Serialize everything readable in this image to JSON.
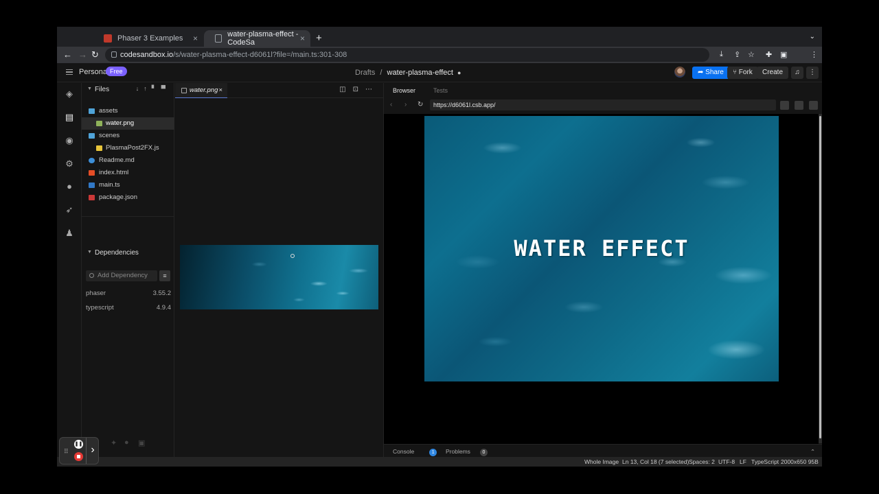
{
  "browser": {
    "tabs": [
      {
        "title": "Phaser 3 Examples",
        "close": "×"
      },
      {
        "title": "water-plasma-effect - CodeSa",
        "close": "×"
      }
    ],
    "new_tab": "+",
    "url_host": "codesandbox.io",
    "url_path": "/s/water-plasma-effect-d6061l?file=/main.ts:301-308"
  },
  "header": {
    "workspace": "Personal",
    "plan_badge": "Free",
    "crumb_parent": "Drafts",
    "crumb_sep": "/",
    "sandbox_name": "water-plasma-effect",
    "share_label": "Share",
    "fork_label": "Fork",
    "create_label": "Create"
  },
  "explorer": {
    "files_title": "Files",
    "tree": [
      {
        "name": "assets",
        "icon": "folder-icon",
        "color": "#4fa3d8"
      },
      {
        "name": "water.png",
        "icon": "image-file-icon",
        "color": "#8fb25a",
        "selected": true
      },
      {
        "name": "scenes",
        "icon": "folder-icon",
        "color": "#4fa3d8"
      },
      {
        "name": "PlasmaPost2FX.js",
        "icon": "js-file-icon",
        "color": "#e8c53a"
      },
      {
        "name": "Readme.md",
        "icon": "info-icon",
        "color": "#3d8fd8"
      },
      {
        "name": "index.html",
        "icon": "html-file-icon",
        "color": "#e44d26"
      },
      {
        "name": "main.ts",
        "icon": "ts-file-icon",
        "color": "#3178c6"
      },
      {
        "name": "package.json",
        "icon": "npm-file-icon",
        "color": "#cb3837"
      }
    ],
    "dependencies_title": "Dependencies",
    "add_dependency_placeholder": "Add Dependency",
    "dependencies": [
      {
        "name": "phaser",
        "version": "3.55.2"
      },
      {
        "name": "typescript",
        "version": "4.9.4"
      }
    ]
  },
  "editor": {
    "tab_label": "water.png",
    "tab_close": "×"
  },
  "preview": {
    "tab_browser": "Browser",
    "tab_tests": "Tests",
    "url": "https://d6061l.csb.app/",
    "canvas_text": "WATER EFFECT",
    "console_label": "Console",
    "console_count": "1",
    "problems_label": "Problems",
    "problems_count": "0"
  },
  "status": {
    "whole_image": "Whole Image",
    "cursor": "Ln 13, Col 18 (7 selected)",
    "spaces": "Spaces: 2",
    "encoding": "UTF-8",
    "eol": "LF",
    "language": "TypeScript",
    "image_info": "2000x650 95B"
  },
  "colors": {
    "share": "#0971f1",
    "badge": "#7b61ff",
    "record": "#e53935"
  }
}
